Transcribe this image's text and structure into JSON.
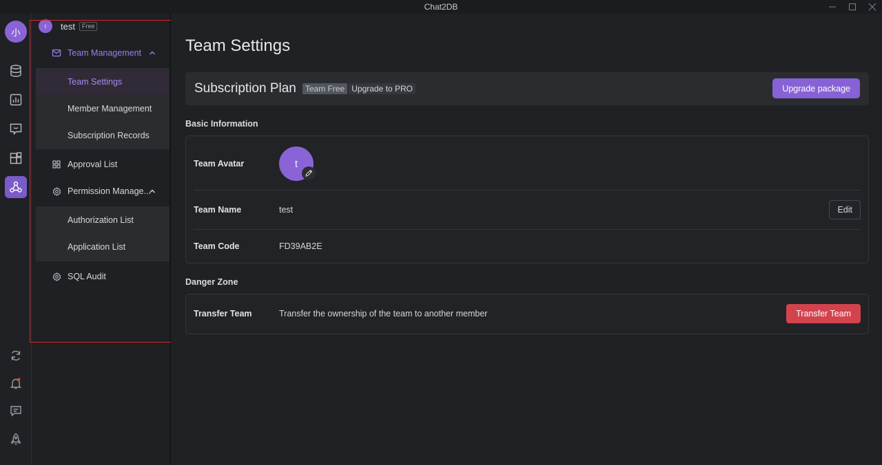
{
  "window": {
    "title": "Chat2DB",
    "min_icon": "minimize-icon",
    "max_icon": "maximize-icon",
    "close_icon": "close-icon"
  },
  "rail": {
    "avatar_text": "小",
    "items": [
      "database-icon",
      "chart-icon",
      "chat-icon",
      "plugins-icon",
      "team-icon"
    ],
    "active": "team-icon",
    "bottom": [
      "refresh-icon",
      "notification-icon",
      "feedback-icon",
      "rocket-icon"
    ]
  },
  "sidebar": {
    "team": {
      "avatar": "t",
      "name": "test",
      "badge": "Free"
    },
    "items": [
      {
        "label": "Team Management",
        "icon": "mail-icon",
        "expanded": true,
        "children": [
          "Team Settings",
          "Member Management",
          "Subscription Records"
        ],
        "active_child": "Team Settings"
      },
      {
        "label": "Approval List",
        "icon": "grid-icon"
      },
      {
        "label": "Permission Manage...",
        "icon": "gear-icon",
        "expanded": true,
        "children": [
          "Authorization List",
          "Application List"
        ]
      },
      {
        "label": "SQL Audit",
        "icon": "gear-icon"
      }
    ]
  },
  "main": {
    "title": "Team Settings",
    "subscription": {
      "title": "Subscription Plan",
      "badge": "Team Free",
      "upgrade_link": "Upgrade to PRO",
      "upgrade_button": "Upgrade package"
    },
    "basic_info": {
      "heading": "Basic Information",
      "avatar_label": "Team Avatar",
      "avatar_text": "t",
      "name_label": "Team Name",
      "name_value": "test",
      "edit_button": "Edit",
      "code_label": "Team Code",
      "code_value": "FD39AB2E"
    },
    "danger": {
      "heading": "Danger Zone",
      "label": "Transfer Team",
      "description": "Transfer the ownership of the team to another member",
      "button": "Transfer Team"
    }
  },
  "colors": {
    "accent": "#8762d6",
    "danger": "#d2434e",
    "highlight": "#d42a2a"
  }
}
